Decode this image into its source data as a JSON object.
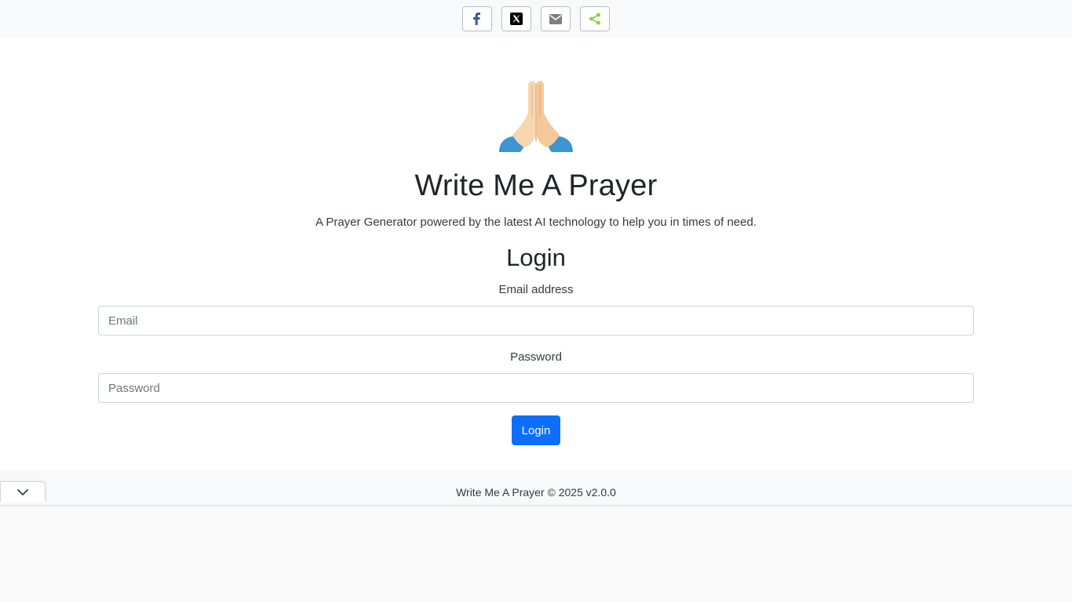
{
  "share": {
    "buttons": [
      {
        "name": "facebook",
        "icon": "facebook-icon",
        "color": "#3b5998"
      },
      {
        "name": "x",
        "icon": "x-icon",
        "color": "#000000"
      },
      {
        "name": "email",
        "icon": "email-icon",
        "color": "#7d7d7d"
      },
      {
        "name": "share",
        "icon": "share-icon",
        "color": "#95d03a"
      }
    ]
  },
  "hero": {
    "icon": "praying-hands-icon",
    "title": "Write Me A Prayer",
    "tagline": "A Prayer Generator powered by the latest AI technology to help you in times of need."
  },
  "login": {
    "heading": "Login",
    "email_label": "Email address",
    "email_placeholder": "Email",
    "email_value": "",
    "password_label": "Password",
    "password_placeholder": "Password",
    "password_value": "",
    "submit_label": "Login",
    "accent_color": "#0d6efd"
  },
  "footer": {
    "text": "Write Me A Prayer © 2025 v2.0.0",
    "collapse_icon": "chevron-down-icon"
  }
}
